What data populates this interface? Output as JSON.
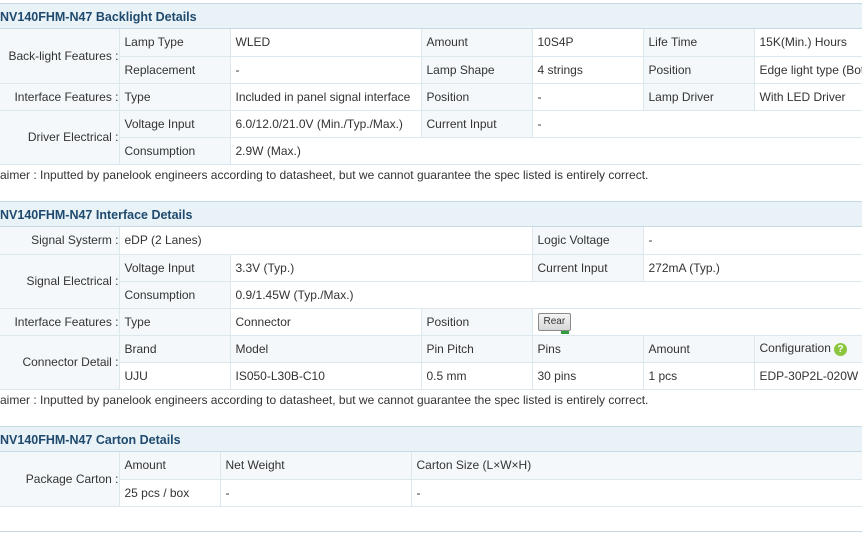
{
  "backlight": {
    "title": "NV140FHM-N47 Backlight Details",
    "backlight_features_label": "Back-light Features :",
    "lamp_type_label": "Lamp Type",
    "lamp_type": "WLED",
    "amount_label": "Amount",
    "amount": "10S4P",
    "life_time_label": "Life Time",
    "life_time": "15K(Min.) Hours",
    "replacement_label": "Replacement",
    "replacement": "-",
    "lamp_shape_label": "Lamp Shape",
    "lamp_shape": "4 strings",
    "position_label": "Position",
    "position": "Edge light type (Bot",
    "interface_features_label": "Interface Features :",
    "type_label": "Type",
    "type": "Included in panel signal interface",
    "iface_position_label": "Position",
    "iface_position": "-",
    "lamp_driver_label": "Lamp Driver",
    "lamp_driver": "With LED Driver",
    "driver_electrical_label": "Driver Electrical :",
    "voltage_input_label": "Voltage Input",
    "voltage_input": "6.0/12.0/21.0V (Min./Typ./Max.)",
    "current_input_label": "Current Input",
    "current_input": "-",
    "consumption_label": "Consumption",
    "consumption": "2.9W (Max.)",
    "disclaimer": "aimer : Inputted by panelook engineers according to datasheet, but we cannot guarantee the spec listed is entirely correct."
  },
  "interface": {
    "title": "NV140FHM-N47 Interface Details",
    "signal_system_label": "Signal Systerm :",
    "signal_system": "eDP (2 Lanes)",
    "logic_voltage_label": "Logic Voltage",
    "logic_voltage": "-",
    "signal_electrical_label": "Signal Electrical :",
    "voltage_input_label": "Voltage Input",
    "voltage_input": "3.3V (Typ.)",
    "current_input_label": "Current Input",
    "current_input": "272mA (Typ.)",
    "consumption_label": "Consumption",
    "consumption": "0.9/1.45W (Typ./Max.)",
    "interface_features_label": "Interface Features :",
    "type_label": "Type",
    "type": "Connector",
    "position_label": "Position",
    "rear_button": "Rear",
    "connector_detail_label": "Connector Detail :",
    "brand_label": "Brand",
    "brand": "UJU",
    "model_label": "Model",
    "model": "IS050-L30B-C10",
    "pin_pitch_label": "Pin Pitch",
    "pin_pitch": "0.5 mm",
    "pins_label": "Pins",
    "pins": "30 pins",
    "amount_label": "Amount",
    "amount": "1 pcs",
    "configuration_label": "Configuration",
    "configuration": "EDP-30P2L-020W",
    "help_glyph": "?",
    "disclaimer": "aimer : Inputted by panelook engineers according to datasheet, but we cannot guarantee the spec listed is entirely correct."
  },
  "carton": {
    "title": "NV140FHM-N47 Carton Details",
    "package_carton_label": "Package Carton :",
    "amount_label": "Amount",
    "amount": "25 pcs / box",
    "net_weight_label": "Net Weight",
    "net_weight": "-",
    "carton_size_label": "Carton Size (L×W×H)",
    "carton_size": "-"
  },
  "colors": {
    "header_bg": "#e9f2f7",
    "title_text": "#1f4a6e",
    "label_bg": "#f4f8fa",
    "border": "#dde8ee"
  }
}
